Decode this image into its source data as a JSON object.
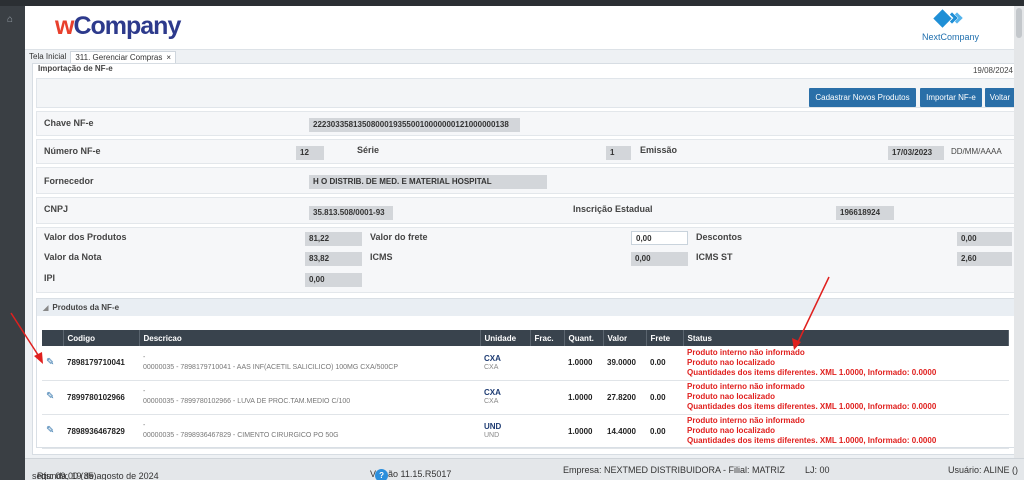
{
  "app": {
    "logo_w": "w",
    "logo_rest": "Company",
    "partner_logo": "NextCompany",
    "accent": "#2a6fa8",
    "error_color": "#e0201e"
  },
  "tabs": [
    {
      "label": "Tela Inicial"
    },
    {
      "label": "311. Gerenciar Compras",
      "close": "×"
    }
  ],
  "page": {
    "title": "Importação de NF-e",
    "date": "19/08/2024"
  },
  "buttons": {
    "cadastrar": "Cadastrar Novos Produtos",
    "importar": "Importar NF-e",
    "voltar": "Voltar"
  },
  "form": {
    "chave_label": "Chave NF-e",
    "chave_value": "22230335813508000193550010000000121000000138",
    "numero_label": "Número NF-e",
    "numero_value": "12",
    "serie_label": "Série",
    "serie_value": "1",
    "emissao_label": "Emissão",
    "emissao_value": "17/03/2023",
    "emissao_format": "DD/MM/AAAA",
    "fornecedor_label": "Fornecedor",
    "fornecedor_value": "H O DISTRIB. DE MED. E MATERIAL HOSPITAL",
    "cnpj_label": "CNPJ",
    "cnpj_value": "35.813.508/0001-93",
    "ie_label": "Inscrição Estadual",
    "ie_value": "196618924",
    "valor_produtos_label": "Valor dos Produtos",
    "valor_produtos_value": "81,22",
    "valor_frete_label": "Valor do frete",
    "valor_frete_value": "0,00",
    "descontos_label": "Descontos",
    "descontos_value": "0,00",
    "valor_nota_label": "Valor da Nota",
    "valor_nota_value": "83,82",
    "icms_label": "ICMS",
    "icms_value": "0,00",
    "icms_st_label": "ICMS ST",
    "icms_st_value": "2,60",
    "ipi_label": "IPI",
    "ipi_value": "0,00"
  },
  "products": {
    "section_title": "Produtos da NF-e",
    "columns": [
      "",
      "Codigo",
      "Descricao",
      "Unidade",
      "Frac.",
      "Quant.",
      "Valor",
      "Frete",
      "Status"
    ],
    "rows": [
      {
        "code": "7898179710041",
        "desc_dash": "-",
        "desc": "00000035 - 7898179710041 - AAS INF(ACETIL SALICILICO) 100MG CXA/500CP",
        "unit": "CXA",
        "unit2": "CXA",
        "frac": "",
        "quant": "1.0000",
        "valor": "39.0000",
        "frete": "0.00",
        "status": [
          "Produto interno não informado",
          "Produto nao localizado",
          "Quantidades dos items diferentes. XML 1.0000, Informado: 0.0000"
        ]
      },
      {
        "code": "7899780102966",
        "desc_dash": "-",
        "desc": "00000035 - 7899780102966 - LUVA DE PROC.TAM.MEDIO C/100",
        "unit": "CXA",
        "unit2": "CXA",
        "frac": "",
        "quant": "1.0000",
        "valor": "27.8200",
        "frete": "0.00",
        "status": [
          "Produto interno não informado",
          "Produto nao localizado",
          "Quantidades dos items diferentes. XML 1.0000, Informado: 0.0000"
        ]
      },
      {
        "code": "7898936467829",
        "desc_dash": "-",
        "desc": "00000035 - 7898936467829 - CIMENTO CIRURGICO PO 50G",
        "unit": "UND",
        "unit2": "UND",
        "frac": "",
        "quant": "1.0000",
        "valor": "14.4000",
        "frete": "0.00",
        "status": [
          "Produto interno não informado",
          "Produto nao localizado",
          "Quantidades dos items diferentes. XML 1.0000, Informado: 0.0000"
        ]
      }
    ]
  },
  "statusbar": {
    "date": "segunda, 19 de agosto de 2024",
    "rfs": "Rfs: 09:00 (35)",
    "version": "Versão 11.15.R5017",
    "help": "?",
    "empresa": "Empresa: NEXTMED DISTRIBUIDORA - Filial: MATRIZ",
    "lj": "LJ: 00",
    "usuario": "Usuário: ALINE ()"
  }
}
